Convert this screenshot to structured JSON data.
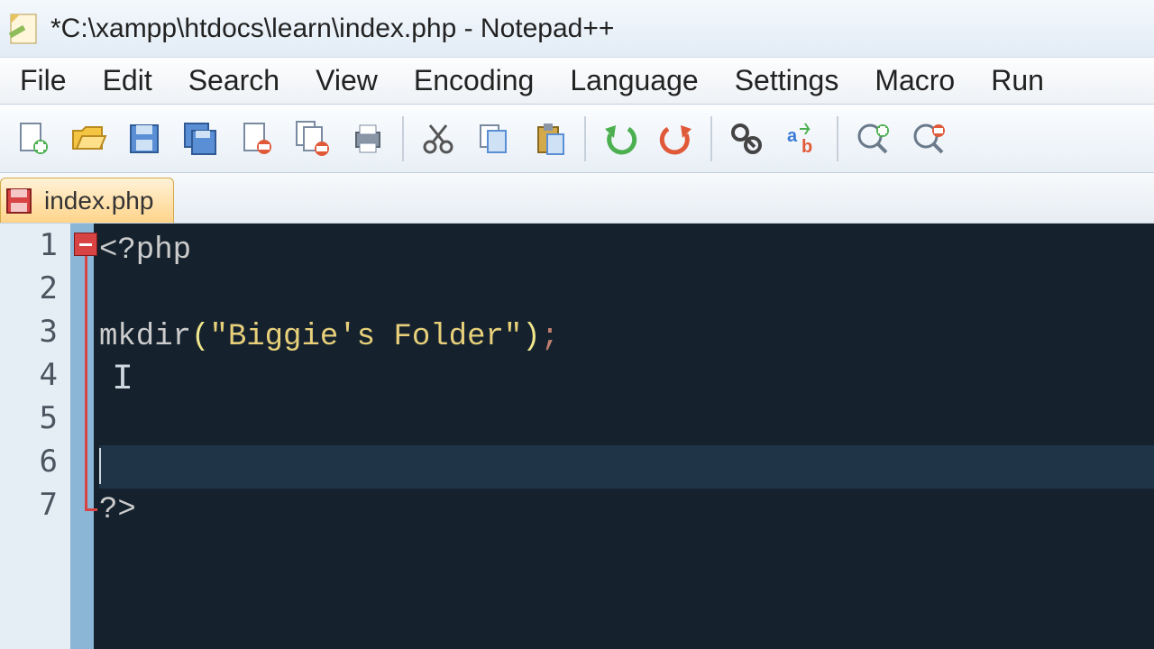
{
  "window": {
    "title": "*C:\\xampp\\htdocs\\learn\\index.php - Notepad++"
  },
  "menu": {
    "file": "File",
    "edit": "Edit",
    "search": "Search",
    "view": "View",
    "encoding": "Encoding",
    "language": "Language",
    "settings": "Settings",
    "macro": "Macro",
    "run": "Run"
  },
  "toolbar": {
    "new": "new-file",
    "open": "open-file",
    "save": "save",
    "saveall": "save-all",
    "close": "close",
    "closeall": "close-all",
    "print": "print",
    "cut": "cut",
    "copy": "copy",
    "paste": "paste",
    "undo": "undo",
    "redo": "redo",
    "find": "find",
    "replace": "replace",
    "zoomin": "zoom-in",
    "zoomout": "zoom-out"
  },
  "tabs": {
    "active": {
      "label": "index.php"
    }
  },
  "code": {
    "line1_open": "<?php",
    "line2": "",
    "line3_fn": "mkdir",
    "line3_lpar": "(",
    "line3_str": "\"Biggie's Folder\"",
    "line3_rpar": ")",
    "line3_semi": ";",
    "line4": "",
    "line5": "",
    "line6": "",
    "line7_close": "?>"
  },
  "linenumbers": [
    "1",
    "2",
    "3",
    "4",
    "5",
    "6",
    "7"
  ]
}
